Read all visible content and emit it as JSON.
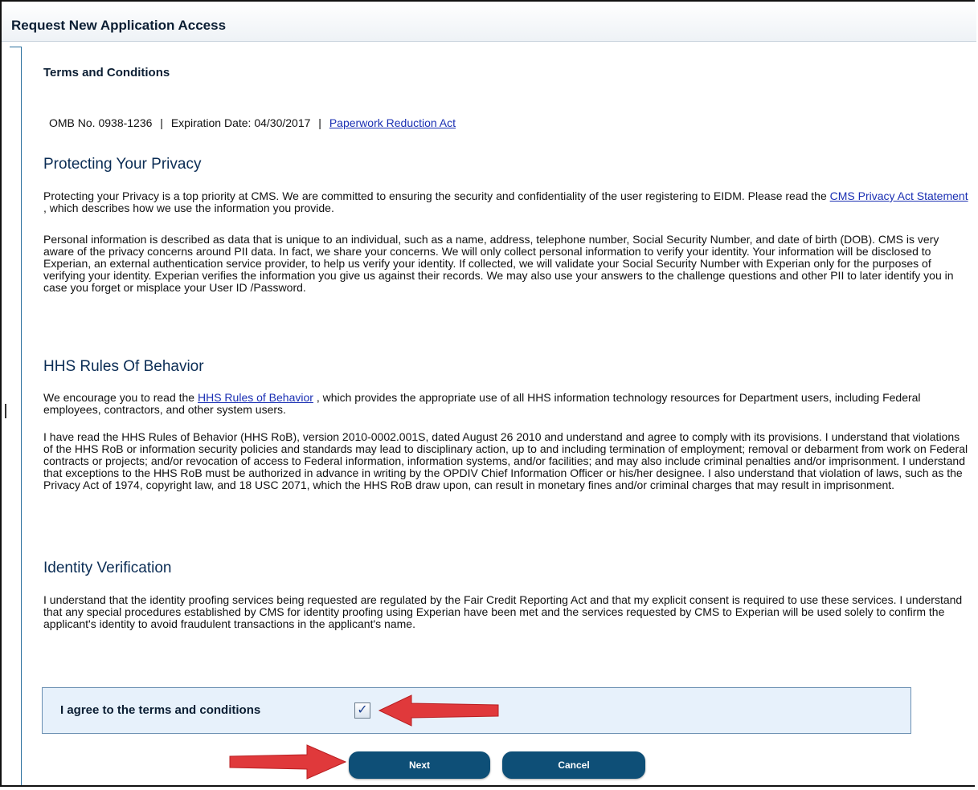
{
  "header": {
    "title": "Request New Application Access"
  },
  "terms": {
    "section_label": "Terms and Conditions",
    "omb_number": "OMB No. 0938-1236",
    "expiration": "Expiration Date: 04/30/2017",
    "paperwork_link": "Paperwork Reduction Act",
    "separator": "|"
  },
  "privacy": {
    "heading": "Protecting Your Privacy",
    "p1_before": "Protecting your Privacy is a top priority at CMS. We are committed to ensuring the security and confidentiality of the user registering to EIDM. Please read the ",
    "p1_link": "CMS Privacy Act Statement",
    "p1_after": " , which describes how we use the information you provide.",
    "p2": "Personal information is described as data that is unique to an individual, such as a name, address, telephone number, Social Security Number, and date of birth (DOB). CMS is very aware of the privacy concerns around PII data. In fact, we share your concerns. We will only collect personal information to verify your identity. Your information will be disclosed to Experian, an external authentication service provider, to help us verify your identity. If collected, we will validate your Social Security Number with Experian only for the purposes of verifying your identity. Experian verifies the information you give us against their records. We may also use your answers to the challenge questions and other PII to later identify you in case you forget or misplace your User ID /Password."
  },
  "rules": {
    "heading": "HHS Rules Of Behavior",
    "p1_before": "We encourage you to read the ",
    "p1_link": "HHS Rules of Behavior",
    "p1_after": " , which provides the appropriate use of all HHS information technology resources for Department users, including Federal employees, contractors, and other system users.",
    "p2": "I have read the HHS Rules of Behavior (HHS RoB), version 2010-0002.001S, dated August 26 2010 and understand and agree to comply with its provisions. I understand that violations of the HHS RoB or information security policies and standards may lead to disciplinary action, up to and including termination of employment; removal or debarment from work on Federal contracts or projects; and/or revocation of access to Federal information, information systems, and/or facilities; and may also include criminal penalties and/or imprisonment. I understand that exceptions to the HHS RoB must be authorized in advance in writing by the OPDIV Chief Information Officer or his/her designee. I also understand that violation of laws, such as the Privacy Act of 1974, copyright law, and 18 USC 2071, which the HHS RoB draw upon, can result in monetary fines and/or criminal charges that may result in imprisonment."
  },
  "identity": {
    "heading": "Identity Verification",
    "p1": "I understand that the identity proofing services being requested are regulated by the Fair Credit Reporting Act and that my explicit consent is required to use these services. I understand that any special procedures established by CMS for identity proofing using Experian have been met and the services requested by CMS to Experian will be used solely to confirm the applicant's identity to avoid fraudulent transactions in the applicant's name."
  },
  "agreement": {
    "label": "I agree to the terms and conditions",
    "checked": true,
    "check_glyph": "✓"
  },
  "actions": {
    "next_label": "Next",
    "cancel_label": "Cancel"
  },
  "colors": {
    "button": "#0e4f77",
    "link": "#1a2fb3",
    "heading": "#0b2d55",
    "annotation_arrow": "#e0393b"
  }
}
